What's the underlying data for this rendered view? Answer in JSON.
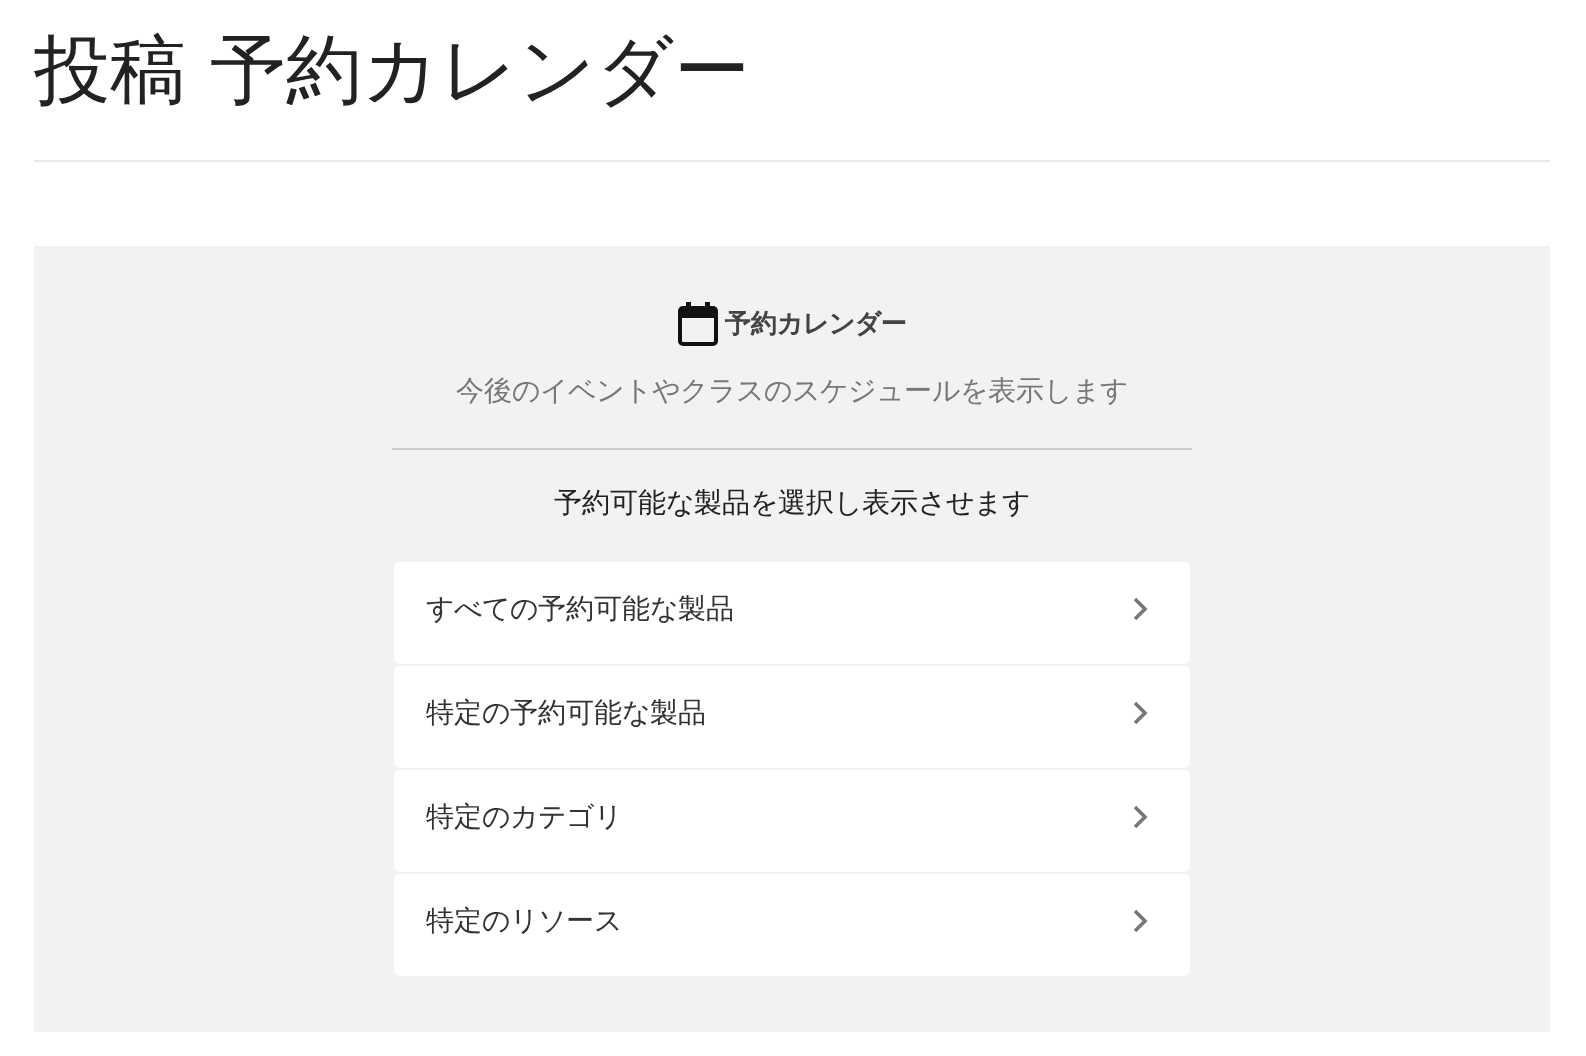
{
  "page_title": "投稿 予約カレンダー",
  "block": {
    "heading": "予約カレンダー",
    "description": "今後のイベントやクラスのスケジュールを表示します",
    "instruction": "予約可能な製品を選択し表示させます",
    "options": [
      {
        "label": "すべての予約可能な製品"
      },
      {
        "label": "特定の予約可能な製品"
      },
      {
        "label": "特定のカテゴリ"
      },
      {
        "label": "特定のリソース"
      }
    ]
  }
}
